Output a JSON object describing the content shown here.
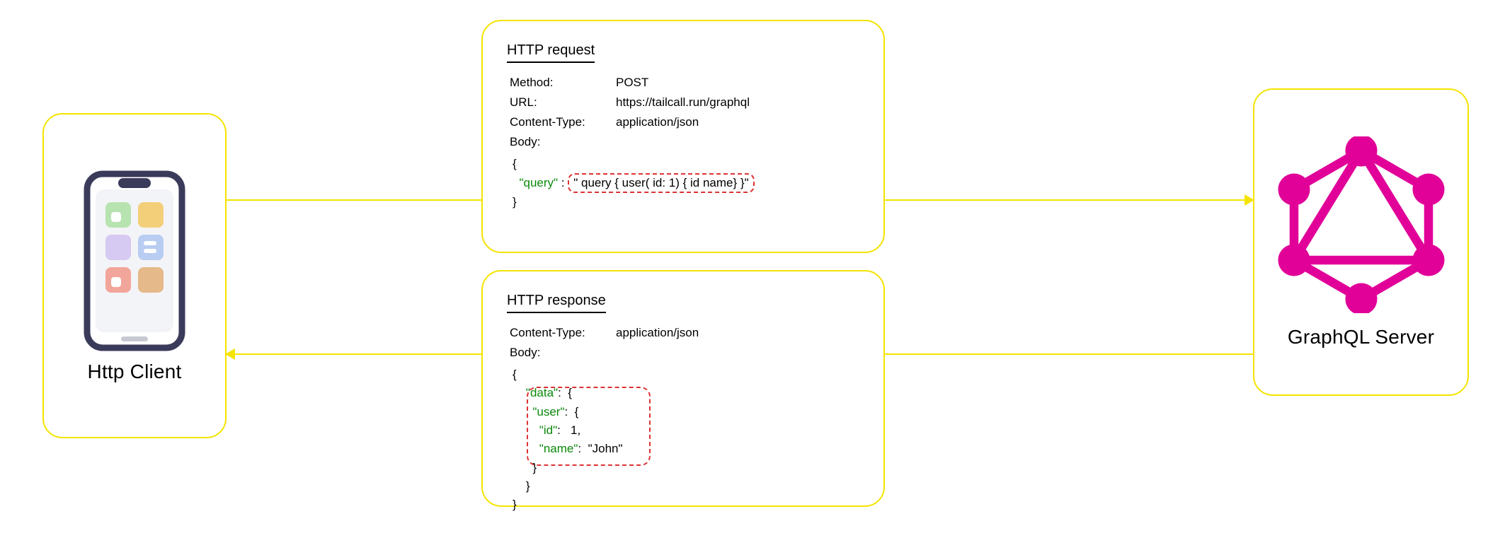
{
  "client": {
    "label": "Http Client"
  },
  "server": {
    "label": "GraphQL Server"
  },
  "request": {
    "title": "HTTP request",
    "method_label": "Method:",
    "method": "POST",
    "url_label": "URL:",
    "url": "https://tailcall.run/graphql",
    "ct_label": "Content-Type:",
    "ct": "application/json",
    "body_label": "Body:",
    "open_brace": "{",
    "query_key": "\"query\"",
    "colon": " : ",
    "query_value": "\" query { user( id: 1) { id name} }\"",
    "close_brace": "}"
  },
  "response": {
    "title": "HTTP response",
    "ct_label": "Content-Type:",
    "ct": "application/json",
    "body_label": "Body:",
    "l1": "{",
    "l2_key": "\"data\"",
    "l2_rest": ":  {",
    "l3_key": "\"user\"",
    "l3_rest": ":  {",
    "l4_key": "\"id\"",
    "l4_rest": ":   1,",
    "l5_key": "\"name\"",
    "l5_rest": ":  \"John\"",
    "l6": "      }",
    "l7": "    }",
    "l8": "}"
  }
}
